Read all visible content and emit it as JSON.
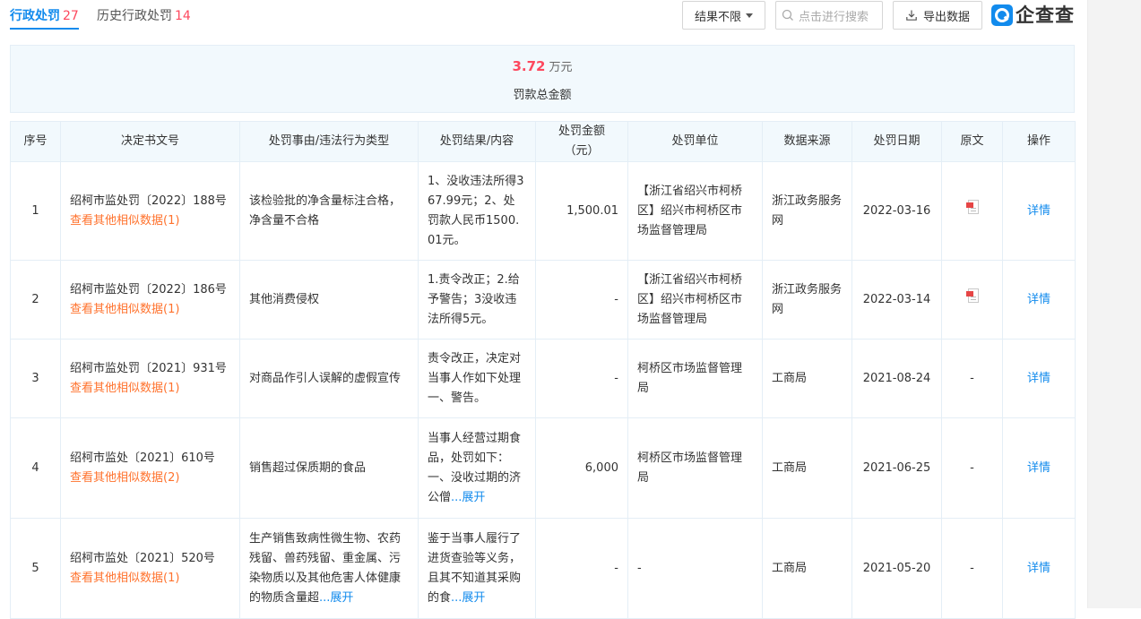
{
  "tabs": [
    {
      "label": "行政处罚",
      "count": "27"
    },
    {
      "label": "历史行政处罚",
      "count": "14"
    }
  ],
  "toolbar": {
    "filter_label": "结果不限",
    "search_placeholder": "点击进行搜索",
    "export_label": "导出数据",
    "logo_text": "企查查"
  },
  "summary": {
    "value": "3.72",
    "unit": "万元",
    "label": "罚款总金额"
  },
  "columns": [
    "序号",
    "决定书文号",
    "处罚事由/违法行为类型",
    "处罚结果/内容",
    "处罚金额（元）",
    "处罚单位",
    "数据来源",
    "处罚日期",
    "原文",
    "操作"
  ],
  "rows": [
    {
      "idx": "1",
      "doc_no": "绍柯市监处罚〔2022〕188号",
      "similar": "查看其他相似数据(1)",
      "reason": "该检验批的净含量标注合格，净含量不合格",
      "reason_expand": "",
      "result": "1、没收违法所得367.99元；2、处罚款人民币1500.01元。",
      "result_expand": "",
      "amount": "1,500.01",
      "org": "【浙江省绍兴市柯桥区】绍兴市柯桥区市场监督管理局",
      "source": "浙江政务服务网",
      "date": "2022-03-16",
      "original": "pdf",
      "original_text": "",
      "action": "详情"
    },
    {
      "idx": "2",
      "doc_no": "绍柯市监处罚〔2022〕186号",
      "similar": "查看其他相似数据(1)",
      "reason": "其他消费侵权",
      "reason_expand": "",
      "result": "1.责令改正；2.给予警告；3没收违法所得5元。",
      "result_expand": "",
      "amount": "-",
      "org": "【浙江省绍兴市柯桥区】绍兴市柯桥区市场监督管理局",
      "source": "浙江政务服务网",
      "date": "2022-03-14",
      "original": "pdf",
      "original_text": "",
      "action": "详情"
    },
    {
      "idx": "3",
      "doc_no": "绍柯市监处罚〔2021〕931号",
      "similar": "查看其他相似数据(1)",
      "reason": "对商品作引人误解的虚假宣传",
      "reason_expand": "",
      "result": "责令改正，决定对当事人作如下处理一、警告。",
      "result_expand": "",
      "amount": "-",
      "org": "柯桥区市场监督管理局",
      "source": "工商局",
      "date": "2021-08-24",
      "original": "text",
      "original_text": "-",
      "action": "详情"
    },
    {
      "idx": "4",
      "doc_no": "绍柯市监处〔2021〕610号",
      "similar": "查看其他相似数据(2)",
      "reason": "销售超过保质期的食品",
      "reason_expand": "",
      "result": "当事人经营过期食品，处罚如下：一、没收过期的济公僧",
      "result_expand": "...展开",
      "amount": "6,000",
      "org": "柯桥区市场监督管理局",
      "source": "工商局",
      "date": "2021-06-25",
      "original": "text",
      "original_text": "-",
      "action": "详情"
    },
    {
      "idx": "5",
      "doc_no": "绍柯市监处〔2021〕520号",
      "similar": "查看其他相似数据(1)",
      "reason": "生产销售致病性微生物、农药残留、兽药残留、重金属、污染物质以及其他危害人体健康的物质含量超",
      "reason_expand": "...展开",
      "result": "鉴于当事人履行了进货查验等义务，且其不知道其采购的食",
      "result_expand": "...展开",
      "amount": "-",
      "org": "-",
      "source": "工商局",
      "date": "2021-05-20",
      "original": "text",
      "original_text": "-",
      "action": "详情"
    }
  ]
}
